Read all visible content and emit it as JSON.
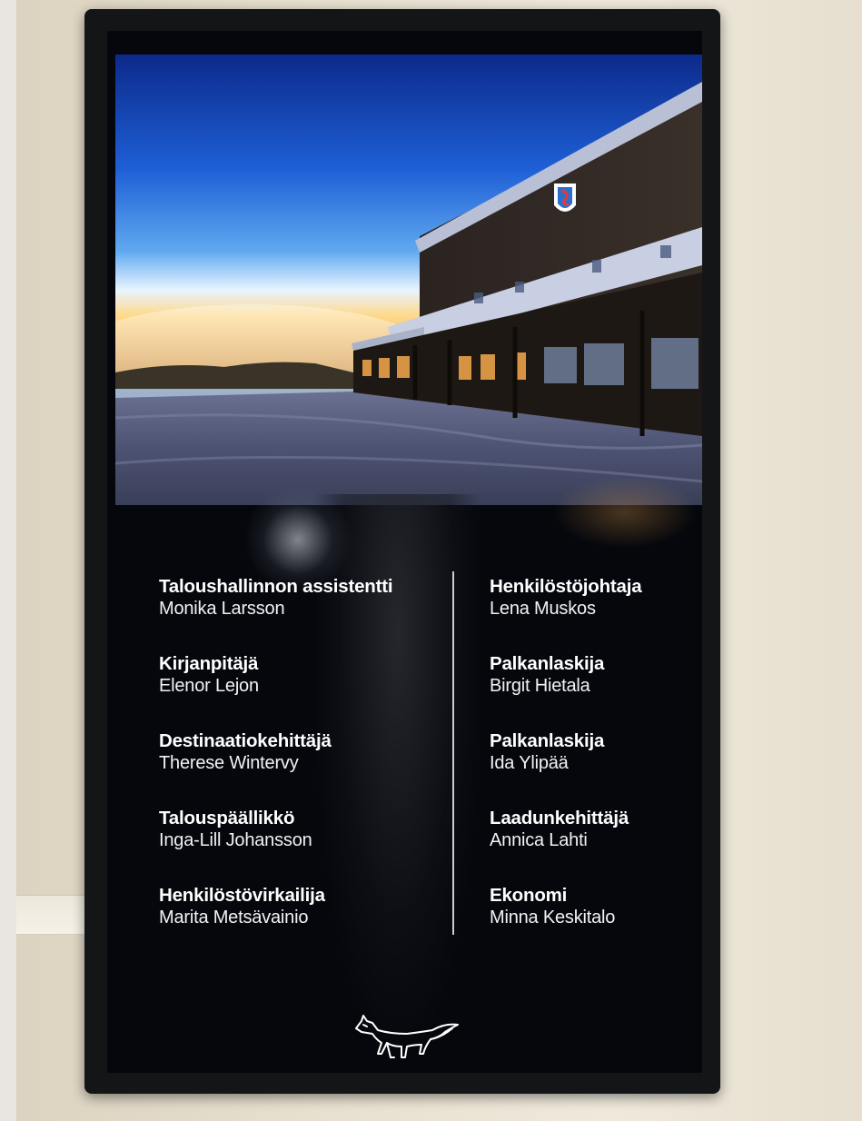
{
  "directory": {
    "left": [
      {
        "role": "Taloushallinnon assistentti",
        "name": "Monika Larsson"
      },
      {
        "role": "Kirjanpitäjä",
        "name": "Elenor Lejon"
      },
      {
        "role": "Destinaatiokehittäjä",
        "name": "Therese Wintervy"
      },
      {
        "role": "Talouspäällikkö",
        "name": "Inga-Lill Johansson"
      },
      {
        "role": "Henkilöstövirkailija",
        "name": "Marita Metsävainio"
      }
    ],
    "right": [
      {
        "role": "Henkilöstöjohtaja",
        "name": "Lena Muskos"
      },
      {
        "role": "Palkanlaskija",
        "name": "Birgit Hietala"
      },
      {
        "role": "Palkanlaskija",
        "name": "Ida Ylipää"
      },
      {
        "role": "Laadunkehittäjä",
        "name": "Annica Lahti"
      },
      {
        "role": "Ekonomi",
        "name": "Minna Keskitalo"
      }
    ]
  },
  "icons": {
    "logo": "fox-icon",
    "building_sign": "shield-logo-icon"
  },
  "colors": {
    "screen_background": "#05070c",
    "text": "#ffffff",
    "divider": "#c9ccd3"
  }
}
